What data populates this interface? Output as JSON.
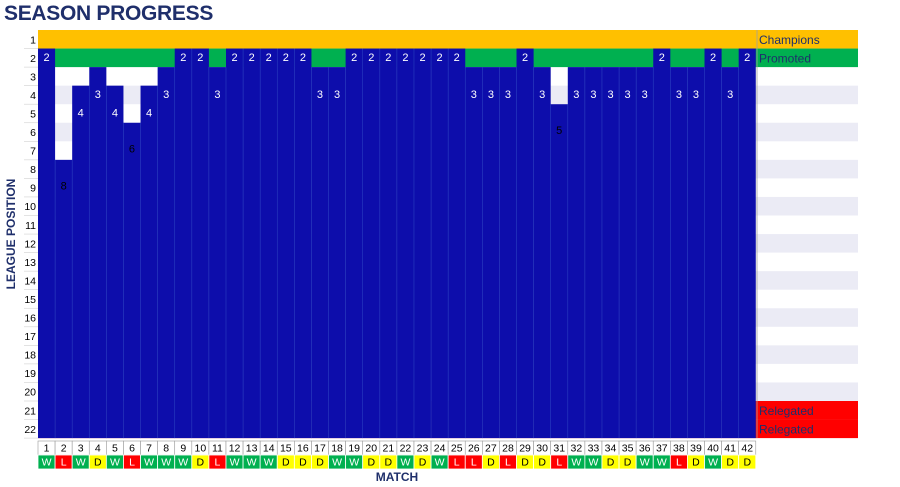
{
  "chart_data": {
    "type": "line",
    "title": "SEASON PROGRESS",
    "xlabel": "MATCH",
    "ylabel": "LEAGUE POSITION",
    "ylim": [
      1,
      22
    ],
    "x": [
      1,
      2,
      3,
      4,
      5,
      6,
      7,
      8,
      9,
      10,
      11,
      12,
      13,
      14,
      15,
      16,
      17,
      18,
      19,
      20,
      21,
      22,
      23,
      24,
      25,
      26,
      27,
      28,
      29,
      30,
      31,
      32,
      33,
      34,
      35,
      36,
      37,
      38,
      39,
      40,
      41,
      42
    ],
    "positions": [
      2,
      8,
      4,
      3,
      4,
      6,
      4,
      3,
      2,
      2,
      3,
      2,
      2,
      2,
      2,
      2,
      3,
      3,
      2,
      2,
      2,
      2,
      2,
      2,
      2,
      3,
      3,
      3,
      2,
      3,
      5,
      3,
      3,
      3,
      3,
      3,
      2,
      3,
      3,
      2,
      3,
      2
    ],
    "results": [
      "W",
      "L",
      "W",
      "D",
      "W",
      "L",
      "W",
      "W",
      "W",
      "D",
      "L",
      "W",
      "W",
      "W",
      "D",
      "D",
      "D",
      "W",
      "W",
      "D",
      "D",
      "W",
      "D",
      "W",
      "L",
      "L",
      "D",
      "L",
      "D",
      "D",
      "L",
      "W",
      "W",
      "D",
      "D",
      "W",
      "W",
      "L",
      "D",
      "W",
      "D",
      "D"
    ],
    "position_labels": [
      "1",
      "2",
      "3",
      "4",
      "5",
      "6",
      "7",
      "8",
      "9",
      "10",
      "11",
      "12",
      "13",
      "14",
      "15",
      "16",
      "17",
      "18",
      "19",
      "20",
      "21",
      "22"
    ],
    "zones": [
      {
        "position": 1,
        "label": "Champions",
        "color": "#ffc000"
      },
      {
        "position": 2,
        "label": "Promoted",
        "color": "#00b050"
      },
      {
        "position": 21,
        "label": "Relegated",
        "color": "#ff0000"
      },
      {
        "position": 22,
        "label": "Relegated",
        "color": "#ff0000"
      }
    ],
    "colors": {
      "fill": "#0d0dab",
      "win": "#00b050",
      "draw": "#ffff00",
      "loss": "#ff0000",
      "band": "#ebebf5",
      "title": "#1f2f6b"
    }
  }
}
